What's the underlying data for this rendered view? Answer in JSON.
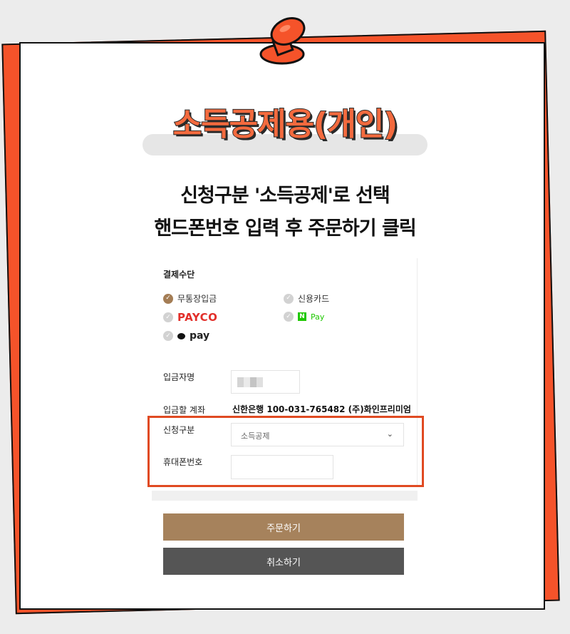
{
  "title": "소득공제용(개인)",
  "instructions": [
    "신청구분 '소득공제'로 선택",
    "핸드폰번호 입력 후 주문하기 클릭"
  ],
  "payment": {
    "section_label": "결제수단",
    "methods": [
      {
        "label": "무통장입금",
        "checked": true
      },
      {
        "label": "신용카드",
        "checked": false
      },
      {
        "label": "PAYCO",
        "checked": false
      },
      {
        "label": "Pay",
        "badge": "N",
        "checked": false
      },
      {
        "label": "pay",
        "checked": false
      }
    ]
  },
  "form": {
    "depositor_label": "입금자명",
    "account_label": "입금할 계좌",
    "account_value": "신한은행 100-031-765482 (주)화인프리미엄",
    "apply_type_label": "신청구분",
    "apply_type_value": "소득공제",
    "phone_label": "휴대폰번호",
    "phone_value": ""
  },
  "buttons": {
    "order": "주문하기",
    "cancel": "취소하기"
  },
  "colors": {
    "accent_orange": "#f5532a",
    "brown": "#a6825c",
    "dark": "#555555",
    "highlight": "#e04a22"
  }
}
